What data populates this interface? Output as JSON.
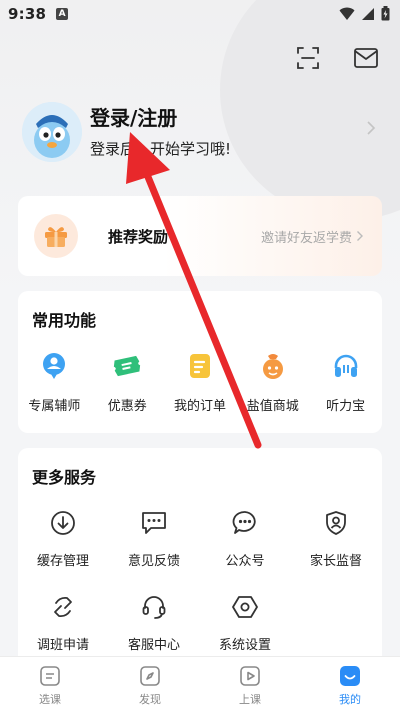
{
  "status_bar": {
    "time": "9:38",
    "notification_letter": "A"
  },
  "profile": {
    "title": "登录/注册",
    "subtitle": "登录后，开始学习哦!"
  },
  "reward": {
    "title": "推荐奖励",
    "invite": "邀请好友返学费"
  },
  "common_functions": {
    "title": "常用功能",
    "items": [
      {
        "label": "专属辅师",
        "icon": "tutor-icon"
      },
      {
        "label": "优惠券",
        "icon": "coupon-icon"
      },
      {
        "label": "我的订单",
        "icon": "order-icon"
      },
      {
        "label": "盐值商城",
        "icon": "mall-icon"
      },
      {
        "label": "听力宝",
        "icon": "headphones-icon"
      }
    ]
  },
  "more_services": {
    "title": "更多服务",
    "items": [
      {
        "label": "缓存管理",
        "icon": "download-icon"
      },
      {
        "label": "意见反馈",
        "icon": "feedback-icon"
      },
      {
        "label": "公众号",
        "icon": "chat-bubble-icon"
      },
      {
        "label": "家长监督",
        "icon": "shield-user-icon"
      },
      {
        "label": "调班申请",
        "icon": "swap-icon"
      },
      {
        "label": "客服中心",
        "icon": "headset-icon"
      },
      {
        "label": "系统设置",
        "icon": "hexagon-settings-icon"
      }
    ]
  },
  "bottom_nav": {
    "items": [
      {
        "label": "选课",
        "icon": "course-select-icon",
        "active": false
      },
      {
        "label": "发现",
        "icon": "compass-icon",
        "active": false
      },
      {
        "label": "上课",
        "icon": "play-icon",
        "active": false
      },
      {
        "label": "我的",
        "icon": "profile-face-icon",
        "active": true
      }
    ]
  },
  "colors": {
    "accent": "#2a8cf6",
    "annotation_arrow": "#e8282b",
    "reward_orange": "#f59a42"
  }
}
